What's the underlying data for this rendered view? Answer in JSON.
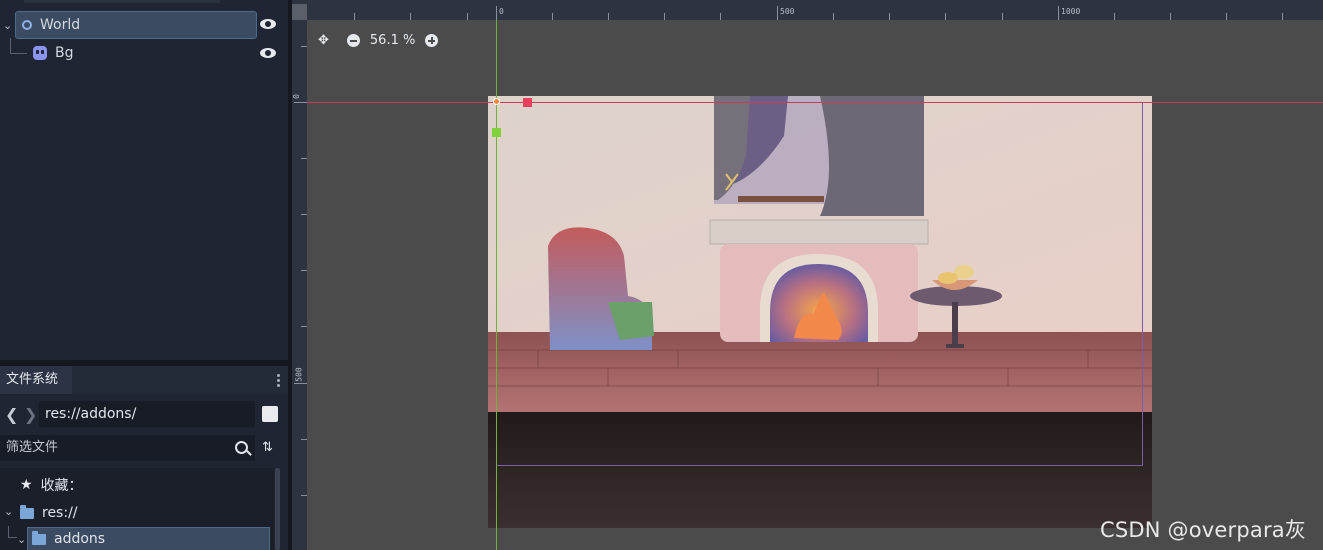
{
  "scene_tree": {
    "nodes": [
      {
        "label": "World",
        "icon": "node2d-circle-icon",
        "selected": true
      },
      {
        "label": "Bg",
        "icon": "sprite-icon",
        "selected": false
      }
    ]
  },
  "filesystem": {
    "tab_label": "文件系统",
    "path": "res://addons/",
    "filter_placeholder": "筛选文件",
    "favorites_label": "收藏：",
    "items": [
      {
        "label": "res://",
        "icon": "folder-icon"
      },
      {
        "label": "addons",
        "icon": "folder-icon",
        "selected": true
      }
    ]
  },
  "viewport": {
    "zoom_label": "56.1 %",
    "ruler_top": [
      "0",
      "500",
      "1000"
    ],
    "ruler_left": [
      "0",
      "500"
    ]
  },
  "watermark": "CSDN @overpara灰",
  "colors": {
    "editor_bg": "#1f2533",
    "viewport_bg": "#4b4b4b",
    "selection": "#3b4b61",
    "guide_green": "#6fb33a",
    "guide_red": "#c24058",
    "frame_purple": "#7b5ca8"
  }
}
